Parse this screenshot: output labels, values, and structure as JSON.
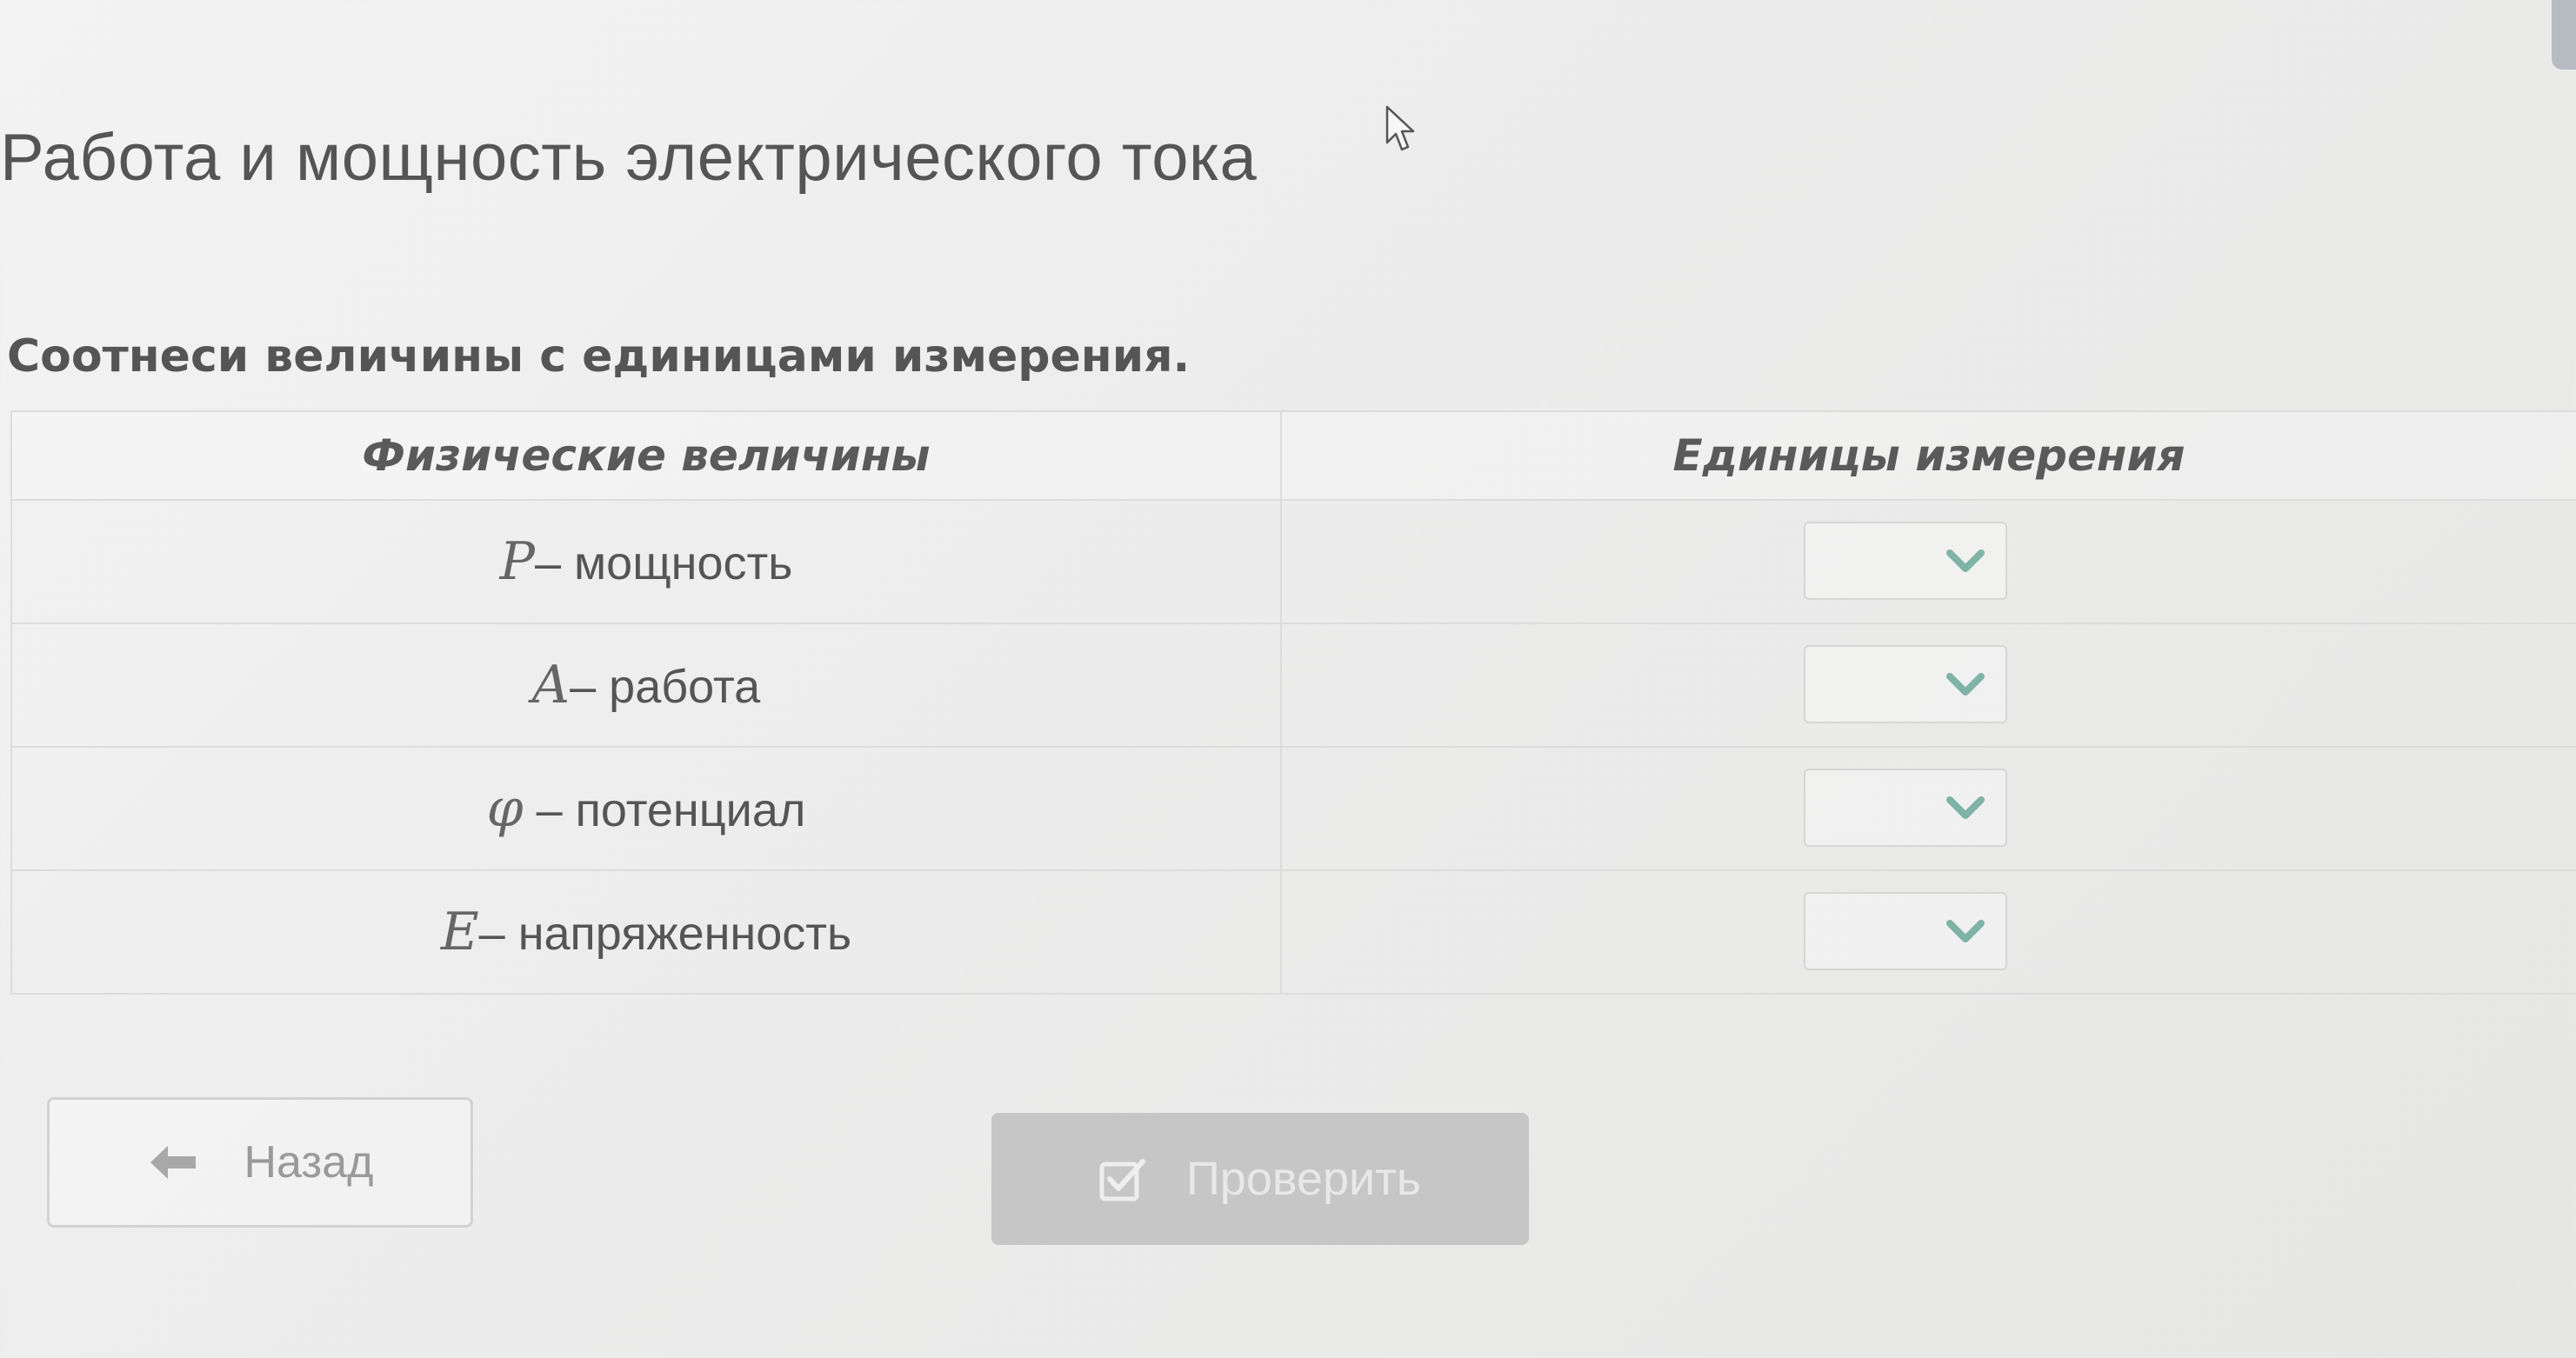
{
  "page": {
    "title": "Работа и мощность электрического тока"
  },
  "task": {
    "instruction": "Соотнеси величины с единицами измерения."
  },
  "table": {
    "headers": {
      "quantities": "Физические величины",
      "units": "Единицы измерения"
    },
    "rows": [
      {
        "symbol": "P",
        "label": "– мощность",
        "unit_value": ""
      },
      {
        "symbol": "A",
        "label": "– работа",
        "unit_value": ""
      },
      {
        "symbol": "φ",
        "label": " – потенциал",
        "unit_value": ""
      },
      {
        "symbol": "E",
        "label": "– напряженность",
        "unit_value": ""
      }
    ]
  },
  "buttons": {
    "back_label": "Назад",
    "check_label": "Проверить"
  },
  "icons": {
    "back": "arrow-left-icon",
    "check": "checkbox-check-icon",
    "dropdown": "chevron-down-icon",
    "cursor": "mouse-pointer-icon"
  },
  "colors": {
    "accent_chevron": "#7fb3a6",
    "check_button_bg": "#c6c6c6",
    "text": "#555555"
  }
}
